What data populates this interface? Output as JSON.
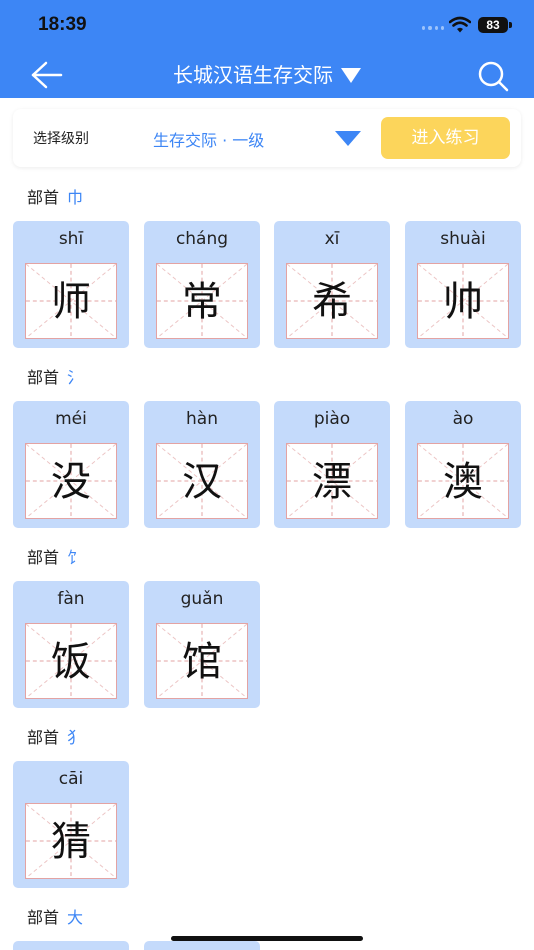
{
  "status_bar": {
    "time": "18:39",
    "battery": "83"
  },
  "header": {
    "title": "长城汉语生存交际"
  },
  "level_selector": {
    "label": "选择级别",
    "value": "生存交际 · 一级",
    "practice_button": "进入练习"
  },
  "radical_prefix": "部首",
  "groups": [
    {
      "radical": "巾",
      "chars": [
        {
          "pinyin": "shī",
          "hanzi": "师"
        },
        {
          "pinyin": "cháng",
          "hanzi": "常"
        },
        {
          "pinyin": "xī",
          "hanzi": "希"
        },
        {
          "pinyin": "shuài",
          "hanzi": "帅"
        }
      ]
    },
    {
      "radical": "氵",
      "chars": [
        {
          "pinyin": "méi",
          "hanzi": "没"
        },
        {
          "pinyin": "hàn",
          "hanzi": "汉"
        },
        {
          "pinyin": "piào",
          "hanzi": "漂"
        },
        {
          "pinyin": "ào",
          "hanzi": "澳"
        }
      ]
    },
    {
      "radical": "饣",
      "chars": [
        {
          "pinyin": "fàn",
          "hanzi": "饭"
        },
        {
          "pinyin": "guǎn",
          "hanzi": "馆"
        }
      ]
    },
    {
      "radical": "犭",
      "chars": [
        {
          "pinyin": "cāi",
          "hanzi": "猜"
        }
      ]
    },
    {
      "radical": "大",
      "chars": []
    }
  ],
  "colors": {
    "accent": "#3d86f5",
    "card_bg": "#c4dafb",
    "practice_button": "#fcd55b",
    "grid_line": "#e3a3a3"
  },
  "icons": {
    "back": "arrow-left-icon",
    "title_dropdown": "caret-down-icon",
    "search": "search-icon",
    "level_dropdown": "caret-down-icon"
  }
}
